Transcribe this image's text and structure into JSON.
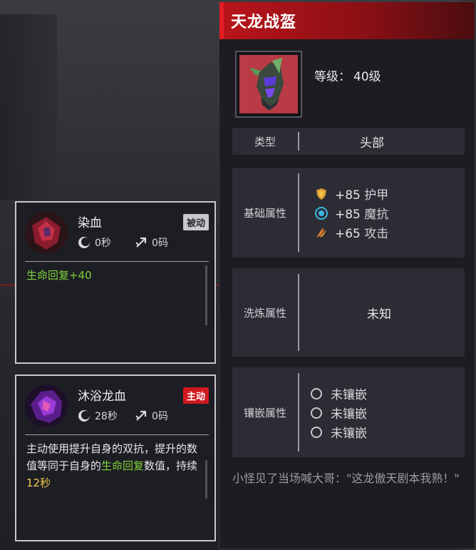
{
  "equipment": {
    "title": "天龙战盔",
    "level_label": "等级：",
    "level_value": "40级",
    "rows": {
      "type_label": "类型",
      "type_value": "头部",
      "base_label": "基础属性",
      "wash_label": "洗炼属性",
      "wash_value": "未知",
      "socket_label": "镶嵌属性"
    },
    "stats": [
      {
        "icon": "armor-shield-icon",
        "value": "+85",
        "name": "护甲",
        "color": "#e0a030"
      },
      {
        "icon": "magic-resist-icon",
        "value": "+85",
        "name": "魔抗",
        "color": "#3bb8e8"
      },
      {
        "icon": "attack-claw-icon",
        "value": "+65",
        "name": "攻击",
        "color": "#e07a20"
      }
    ],
    "sockets": [
      "未镶嵌",
      "未镶嵌",
      "未镶嵌"
    ],
    "quote": "小怪见了当场喊大哥：\"这龙傲天剧本我熟！\""
  },
  "skills": [
    {
      "name": "染血",
      "badge": "被动",
      "cooldown": "0秒",
      "range": "0码",
      "desc_green": "生命回复+40"
    },
    {
      "name": "沐浴龙血",
      "badge": "主动",
      "cooldown": "28秒",
      "range": "0码",
      "desc_1": "主动使用提升自身的双抗，提升的数值等同于自身的",
      "desc_green": "生命回复",
      "desc_2": "数值，持续",
      "desc_yellow": "12秒"
    }
  ],
  "colors": {
    "accent": "#d01820",
    "heal": "#7fd33a",
    "duration": "#f2c94c"
  }
}
